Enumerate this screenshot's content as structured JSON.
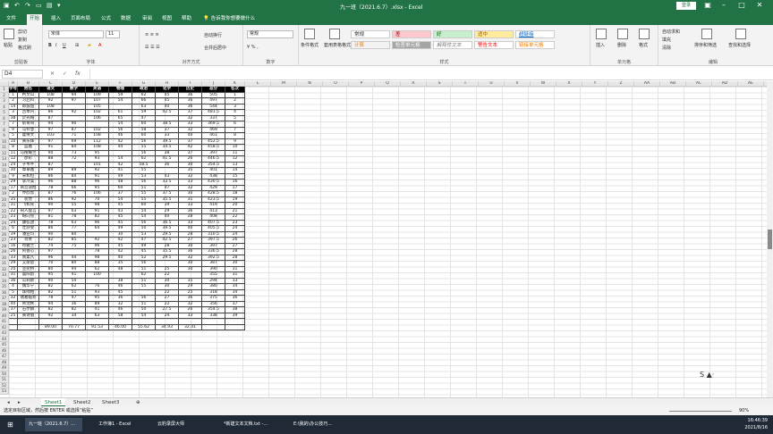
{
  "titlebar": {
    "title": "九一班（2021.6.7）.xlsx - Excel",
    "login": "登录",
    "qa_icons": [
      "save-icon",
      "undo-icon",
      "redo-icon",
      "file-icon",
      "print-icon",
      "more-icon"
    ]
  },
  "ribbon_tabs": [
    "文件",
    "开始",
    "插入",
    "页面布局",
    "公式",
    "数据",
    "审阅",
    "视图",
    "帮助",
    "💡 告诉我你想要做什么"
  ],
  "ribbon": {
    "clipboard": {
      "paste": "粘贴",
      "cut": "剪切",
      "copy": "复制",
      "painter": "格式刷",
      "label": "剪贴板"
    },
    "font": {
      "name": "宋体",
      "size": "11",
      "label": "字体"
    },
    "align": {
      "wrap": "自动换行",
      "merge": "合并后居中",
      "label": "对齐方式"
    },
    "number": {
      "format": "常规",
      "label": "数字"
    },
    "styles": {
      "cond": "条件格式",
      "table": "套用表格格式",
      "normal": "常规",
      "bad": "差",
      "good": "好",
      "neutral": "适中",
      "hyper": "超链接",
      "calc": "计算",
      "check": "检查单元格",
      "expl": "解释性文本",
      "warn": "警告文本",
      "linked": "链接单元格",
      "label": "样式"
    },
    "cells": {
      "insert": "插入",
      "delete": "删除",
      "format": "格式",
      "label": "单元格"
    },
    "edit": {
      "sum": "自动求和",
      "fill": "填充",
      "clear": "清除",
      "sort": "排序和筛选",
      "find": "查找和选择",
      "label": "编辑"
    }
  },
  "formula_bar": {
    "namebox": "D4",
    "fx": "fx",
    "value": ""
  },
  "columns": [
    "A",
    "B",
    "C",
    "D",
    "E",
    "F",
    "G",
    "H",
    "I",
    "J",
    "K",
    "L",
    "M",
    "N",
    "O",
    "P",
    "Q",
    "R",
    "S",
    "T",
    "U",
    "V",
    "W",
    "X",
    "Y",
    "Z",
    "AA",
    "AB",
    "AC",
    "AD",
    "AE",
    "AF"
  ],
  "table": {
    "header": [
      "学号",
      "姓名",
      "语文",
      "数学",
      "英语",
      "物理",
      "政治",
      "化学",
      "历史",
      "总分",
      "名次"
    ],
    "rows": [
      [
        "1",
        "柯文山",
        "108",
        "94",
        "109",
        "59",
        "62",
        "45",
        "36",
        "505",
        "1"
      ],
      [
        "2",
        "习启科",
        "92",
        "97",
        "107",
        "54",
        "66",
        "45",
        "36",
        "497",
        "2"
      ],
      [
        "14",
        "郎鼓韶",
        "108",
        "",
        "105",
        "",
        "63",
        "40",
        "36",
        "544",
        "3"
      ],
      [
        "3",
        "吕本内",
        "86",
        "92",
        "102",
        "61",
        "59",
        "42.5",
        "37",
        "481.5",
        "4"
      ],
      [
        "38",
        "於光帽",
        "87",
        "",
        "106",
        "65",
        "47",
        "",
        "32",
        "337",
        "5"
      ],
      [
        "7",
        "俞哥哥",
        "94",
        "90",
        "",
        "54",
        "60",
        "38.5",
        "33",
        "369.5",
        "6"
      ],
      [
        "9",
        "马铃慧",
        "97",
        "87",
        "102",
        "56",
        "58",
        "37",
        "32",
        "469",
        "7"
      ],
      [
        "5",
        "霍倩文",
        "103",
        "71",
        "108",
        "46",
        "60",
        "33",
        "40",
        "461",
        "8"
      ],
      [
        "10",
        "黄乐辉",
        "97",
        "69",
        "112",
        "42",
        "56",
        "39.5",
        "37",
        "452.5",
        "9"
      ],
      [
        "8",
        "蓝鑫",
        "91",
        "84",
        "108",
        "44",
        "55",
        "34.5",
        "42",
        "458.5",
        "10"
      ],
      [
        "11",
        "马搜耀兰",
        "90",
        "73",
        "95",
        "",
        "56",
        "38",
        "37",
        "397",
        "11"
      ],
      [
        "12",
        "彦彩",
        "88",
        "72",
        "93",
        "54",
        "62",
        "41.5",
        "26",
        "446.5",
        "12"
      ],
      [
        "24",
        "子韦芊",
        "87",
        "",
        "101",
        "42",
        "58.5",
        "36",
        "30",
        "354.5",
        "13"
      ],
      [
        "30",
        "章卓鑫",
        "89",
        "89",
        "92",
        "41",
        "55",
        "",
        "35",
        "401",
        "14"
      ],
      [
        "9",
        "宋和恒",
        "86",
        "84",
        "91",
        "49",
        "53",
        "43",
        "32",
        "438",
        "15"
      ],
      [
        "29",
        "李冷美",
        "96",
        "88",
        "96",
        "48",
        "56",
        "33.5",
        "33",
        "430.5",
        "16"
      ],
      [
        "17",
        "商宫迪旭",
        "78",
        "66",
        "95",
        "60",
        "51",
        "47",
        "32",
        "429",
        "17"
      ],
      [
        "2",
        "乔欣欣",
        "87",
        "76",
        "106",
        "37",
        "55",
        "37.5",
        "30",
        "428.5",
        "18"
      ],
      [
        "35",
        "装琵",
        "86",
        "92",
        "70",
        "54",
        "55",
        "35.5",
        "31",
        "423.5",
        "19"
      ],
      [
        "31",
        "飞和光",
        "90",
        "55",
        "98",
        "45",
        "60",
        "39",
        "33",
        "419",
        "20"
      ],
      [
        "22",
        "祠人殷言",
        "97",
        "63",
        "91",
        "43",
        "54",
        "29",
        "36",
        "413",
        "21"
      ],
      [
        "23",
        "岈向雪",
        "81",
        "78",
        "82",
        "45",
        "54",
        "40",
        "28",
        "408",
        "22"
      ],
      [
        "24",
        "康弘放",
        "78",
        "63",
        "96",
        "45",
        "56",
        "36.5",
        "33",
        "407.5",
        "23"
      ],
      [
        "6",
        "壮舒雯",
        "86",
        "77",
        "64",
        "49",
        "50",
        "39.5",
        "40",
        "405.5",
        "24"
      ],
      [
        "39",
        "潘亚玛",
        "90",
        "80",
        "",
        "30",
        "53",
        "29.5",
        "28",
        "310.5",
        "24"
      ],
      [
        "23",
        "肖胥",
        "82",
        "85",
        "92",
        "42",
        "47",
        "42.5",
        "27",
        "397.5",
        "26"
      ],
      [
        "16",
        "苟雅兰",
        "74",
        "75",
        "96",
        "45",
        "49",
        "28",
        "30",
        "397",
        "27"
      ],
      [
        "26",
        "阿香心",
        "97",
        "",
        "78",
        "42",
        "45",
        "35.5",
        "36",
        "336.5",
        "28"
      ],
      [
        "33",
        "南柔凡",
        "96",
        "44",
        "98",
        "40",
        "52",
        "29.5",
        "32",
        "392.5",
        "28"
      ],
      [
        "29",
        "艾丽思",
        "70",
        "80",
        "88",
        "35",
        "56",
        "",
        "30",
        "387",
        "30"
      ],
      [
        "20",
        "宣宛桥",
        "80",
        "94",
        "62",
        "48",
        "51",
        "25",
        "30",
        "390",
        "31"
      ],
      [
        "31",
        "晨阳韵",
        "95",
        "41",
        "100",
        "",
        "62",
        "22",
        "",
        "355",
        "31"
      ],
      [
        "36",
        "公莉斯",
        "90",
        "50",
        "",
        "38",
        "51",
        "30",
        "35",
        "294",
        "33"
      ],
      [
        "4",
        "魏华宁",
        "82",
        "62",
        "76",
        "46",
        "55",
        "30",
        "29",
        "380",
        "34"
      ],
      [
        "5",
        "珠绿帕",
        "82",
        "51",
        "93",
        "45",
        "",
        "22",
        "25",
        "318",
        "34"
      ],
      [
        "32",
        "诸葛临菲",
        "78",
        "47",
        "95",
        "36",
        "56",
        "27",
        "36",
        "375",
        "36"
      ],
      [
        "40",
        "师沈秩",
        "94",
        "36",
        "89",
        "32",
        "51",
        "22",
        "32",
        "356",
        "37"
      ],
      [
        "37",
        "石尔群",
        "82",
        "82",
        "41",
        "46",
        "50",
        "27.5",
        "26",
        "354.5",
        "38"
      ],
      [
        "25",
        "黄诗眉",
        "92",
        "34",
        "63",
        "58",
        "54",
        "24",
        "33",
        "338",
        "39"
      ]
    ],
    "averages": [
      "",
      "",
      "89.00",
      "70.77",
      "91.53",
      "46.00",
      "55.62",
      "34.93",
      "32.41",
      "",
      ""
    ]
  },
  "sheets": [
    "Sheet1",
    "Sheet2",
    "Sheet3"
  ],
  "statusbar": {
    "text": "选定目标区域，然后按 ENTER 或选择“粘贴”",
    "zoom": "90%"
  },
  "taskbar": {
    "items": [
      "九一班（2021.6.7）...",
      "工作簿1 - Excel",
      "云豹录屏大师",
      "*新建文本文档.txt -...",
      "E:\\我的\\办公技巧..."
    ],
    "time": "16:46:39",
    "date": "2021/8/16"
  },
  "floatbar": "S ▲·"
}
